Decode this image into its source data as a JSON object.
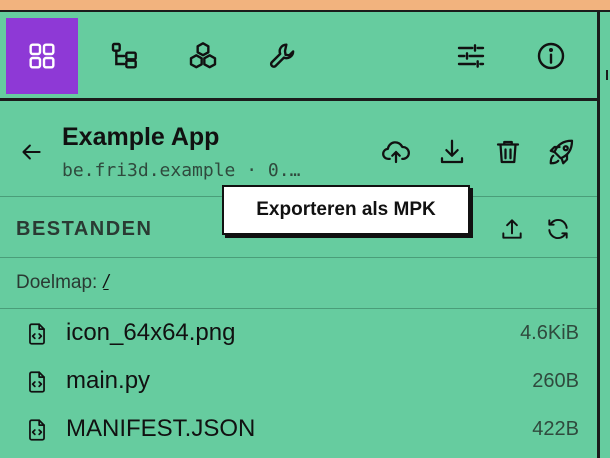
{
  "toolbar": {
    "items": [
      {
        "name": "apps",
        "icon": "grid-icon"
      },
      {
        "name": "tree",
        "icon": "tree-icon"
      },
      {
        "name": "packages",
        "icon": "boxes-icon"
      },
      {
        "name": "tools",
        "icon": "wrench-icon"
      },
      {
        "name": "settings",
        "icon": "sliders-icon"
      },
      {
        "name": "info",
        "icon": "info-icon"
      }
    ],
    "active_color": "#8e39d6"
  },
  "app": {
    "title": "Example App",
    "subtitle": "be.fri3d.example · 0.…"
  },
  "header_actions": [
    {
      "name": "upload-cloud",
      "icon": "cloud-upload-icon"
    },
    {
      "name": "download",
      "icon": "download-icon"
    },
    {
      "name": "delete",
      "icon": "trash-icon"
    },
    {
      "name": "launch",
      "icon": "rocket-icon"
    }
  ],
  "tooltip": {
    "text": "Exporteren als MPK"
  },
  "files": {
    "title": "BESTANDEN",
    "target_label": "Doelmap:",
    "target_path": "/",
    "items": [
      {
        "name": "icon_64x64.png",
        "size": "4.6KiB"
      },
      {
        "name": "main.py",
        "size": "260B"
      },
      {
        "name": "MANIFEST.JSON",
        "size": "422B"
      }
    ]
  },
  "colors": {
    "background": "#66cc9f",
    "top_strip": "#f2b37e",
    "active": "#8e39d6"
  }
}
